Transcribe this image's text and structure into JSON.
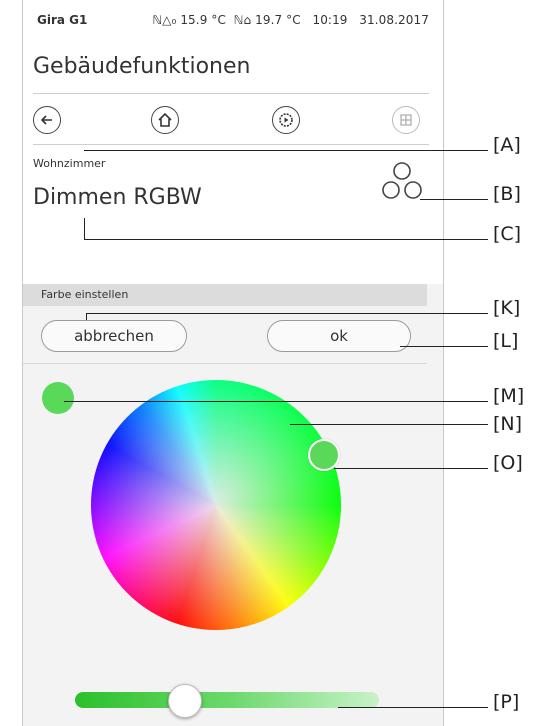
{
  "statusbar": {
    "brand": "Gira G1",
    "status": "ℕΔ₀ 15.9 °C  ℕ⌂ 19.7 °C   10:19   31.08.2017"
  },
  "header": {
    "title": "Gebäudefunktionen"
  },
  "function": {
    "room": "Wohnzimmer",
    "name": "Dimmen RGBW"
  },
  "dialog": {
    "header": "Farbe einstellen",
    "cancel_label": "abbrechen",
    "ok_label": "ok",
    "selected_color": "#5ad85a"
  },
  "slider": {
    "value_fraction": 0.36
  },
  "callouts": [
    "[A]",
    "[B]",
    "[C]",
    "[K]",
    "[L]",
    "[M]",
    "[N]",
    "[O]",
    "[P]"
  ],
  "colors": {
    "accent_green": "#5ad85a",
    "panel_bg": "#f3f3f3",
    "header_bg": "#dcdcdc"
  }
}
